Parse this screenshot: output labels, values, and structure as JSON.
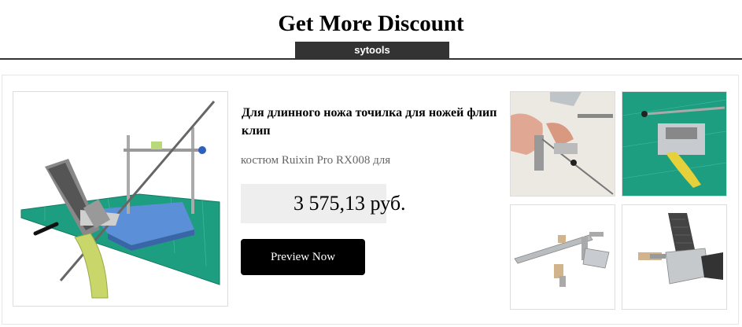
{
  "header": {
    "title": "Get More Discount",
    "tab_label": "sytools"
  },
  "product": {
    "title": "Для длинного ножа точилка для ножей флип клип",
    "subtitle": "костюм Ruixin Pro RX008 для",
    "price": "3 575,13 руб.",
    "cta_label": "Preview Now",
    "main_image_icon": "knife-sharpener-photo",
    "thumbnails": [
      {
        "icon": "sharpener-in-use-photo"
      },
      {
        "icon": "sharpener-on-mat-photo"
      },
      {
        "icon": "sharpener-rail-photo"
      },
      {
        "icon": "sharpener-clamp-closeup-photo"
      }
    ]
  },
  "colors": {
    "header_tab_bg": "#333333",
    "button_bg": "#000000",
    "price_bg": "#eeeeee",
    "mat_green": "#1e9e80",
    "plate_blue": "#5b8fd8",
    "handle_yellow": "#c8d66a"
  }
}
